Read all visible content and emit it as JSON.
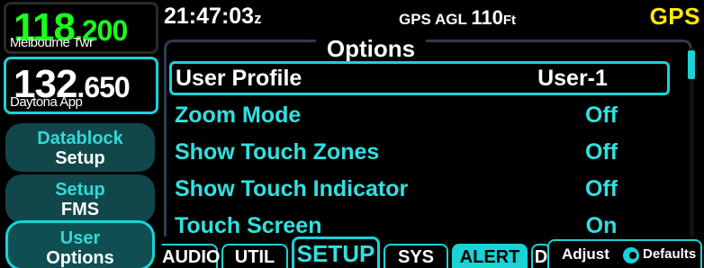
{
  "com": {
    "active": {
      "mhz": "118",
      "khz": ".200",
      "name": "Melbourne Twr"
    },
    "standby": {
      "mhz": "132",
      "khz": ".650",
      "name": "Daytona App"
    }
  },
  "side_buttons": [
    {
      "line1": "Datablock",
      "line2": "Setup"
    },
    {
      "line1": "Setup",
      "line2": "FMS"
    },
    {
      "line1": "User",
      "line2": "Options"
    }
  ],
  "topbar": {
    "time": "21:47:03",
    "time_suffix": "z",
    "gps_agl_label": "GPS AGL",
    "gps_agl_value": "110",
    "gps_agl_unit": "Ft",
    "nav_source": "GPS"
  },
  "options": {
    "title": "Options",
    "rows": [
      {
        "label": "User Profile",
        "value": "User-1"
      },
      {
        "label": "Zoom Mode",
        "value": "Off"
      },
      {
        "label": "Show Touch Zones",
        "value": "Off"
      },
      {
        "label": "Show Touch Indicator",
        "value": "Off"
      },
      {
        "label": "Touch Screen",
        "value": "On"
      }
    ]
  },
  "tabs": [
    "AUDIO",
    "UTIL",
    "SETUP",
    "SYS",
    "ALERT",
    "D"
  ],
  "active_tab": "SETUP",
  "adjust": {
    "label": "Adjust",
    "action": "Defaults",
    "icon": "knob-icon"
  },
  "colors": {
    "accent": "#19d3d6",
    "active_freq": "#19ff19",
    "gps": "#ffea00"
  }
}
